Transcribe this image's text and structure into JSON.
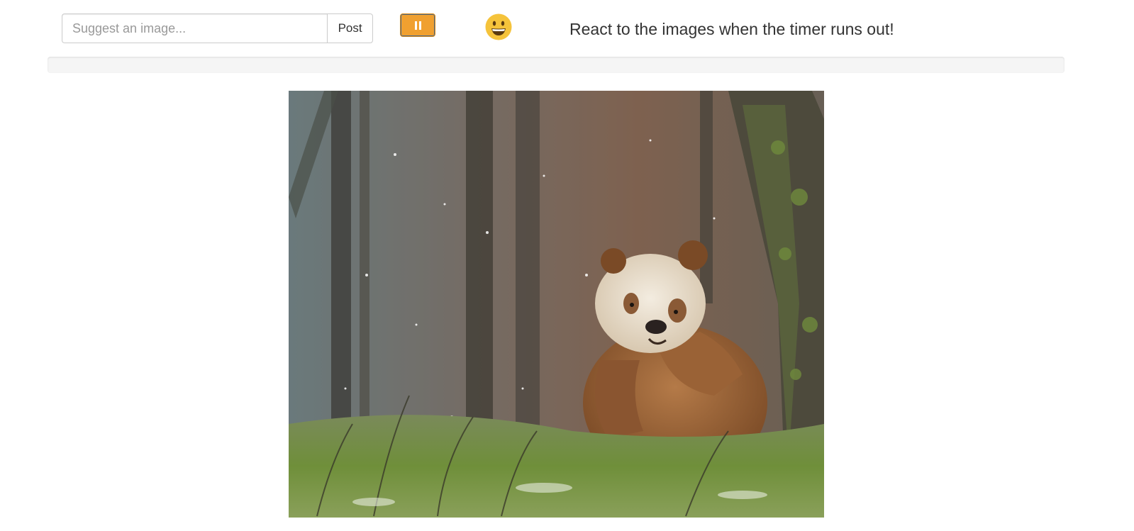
{
  "suggest": {
    "placeholder": "Suggest an image...",
    "value": "",
    "post_label": "Post"
  },
  "controls": {
    "pause_icon": "pause-icon",
    "pause_color": "#f0a030",
    "reaction_icon": "grinning-face-emoji"
  },
  "header": {
    "instruction": "React to the images when the timer runs out!"
  },
  "timer": {
    "progress": 0
  },
  "main_image": {
    "description_icon": "photo-panda-in-snowy-forest"
  }
}
